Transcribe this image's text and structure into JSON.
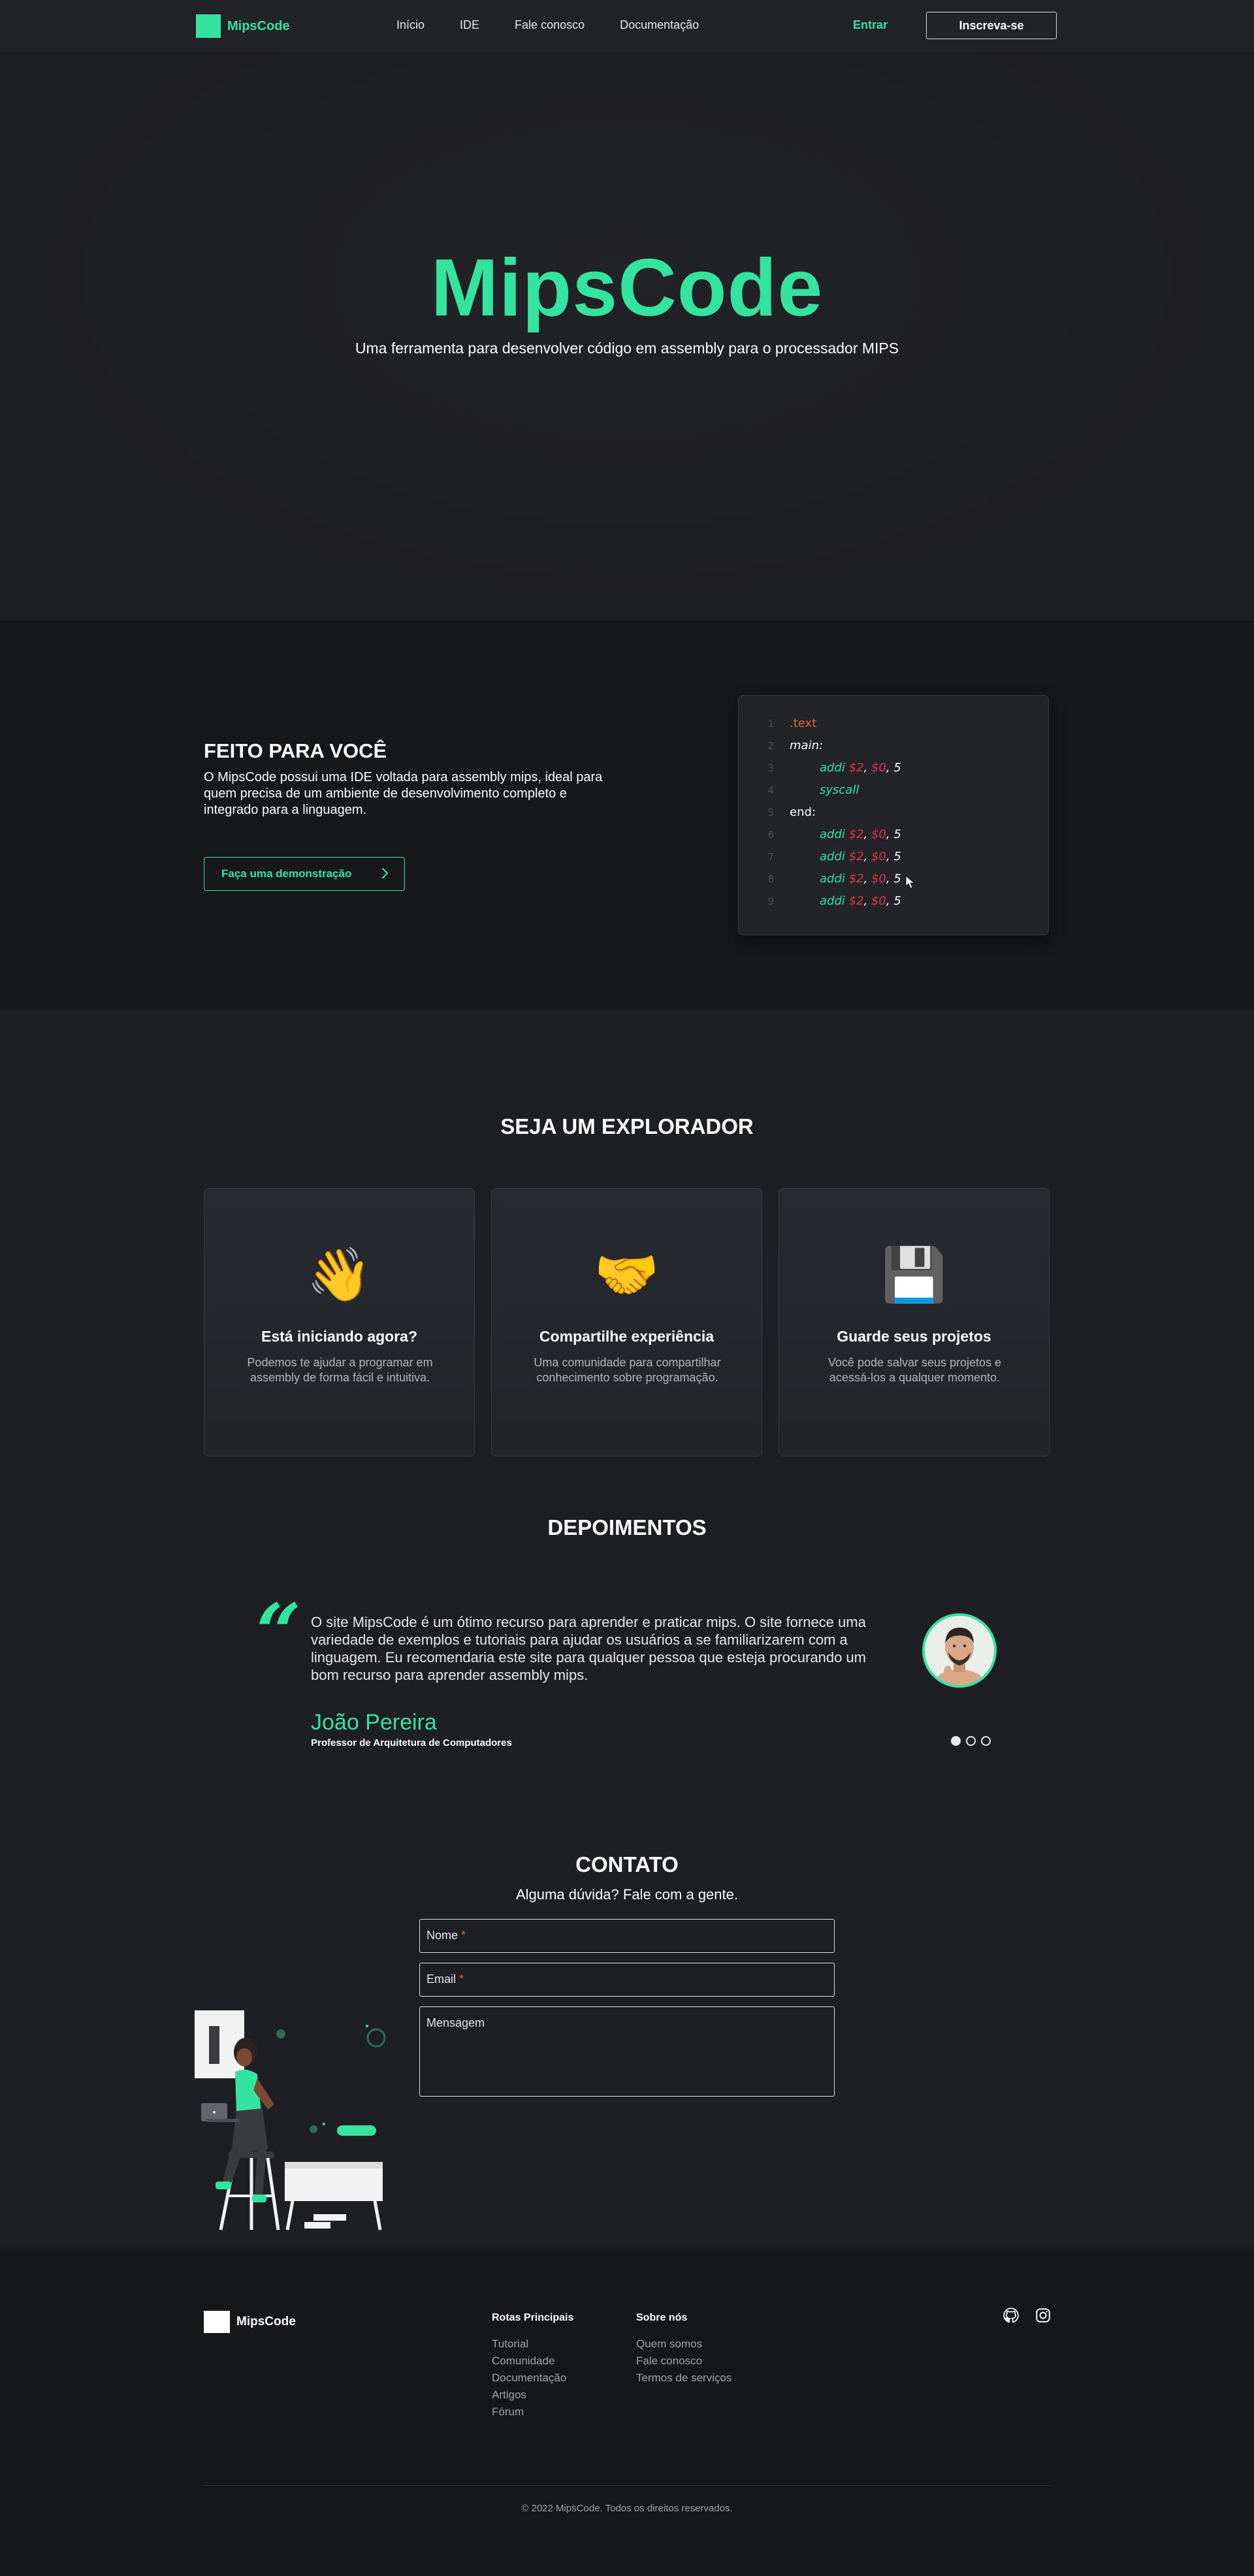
{
  "nav": {
    "brand": "MipsCode",
    "links": [
      "Início",
      "IDE",
      "Fale conosco",
      "Documentação"
    ],
    "login": "Entrar",
    "signup": "Inscreva-se"
  },
  "hero": {
    "title": "MipsCode",
    "subtitle": "Uma ferramenta para desenvolver código em assembly para o processador MIPS"
  },
  "feature": {
    "title": "FEITO PARA VOCÊ",
    "description": "O MipsCode possui uma IDE voltada para assembly mips, ideal para quem precisa de um ambiente de desenvolvimento completo e integrado para a linguagem.",
    "button": "Faça uma demonstração",
    "code_lines": [
      {
        "n": "1",
        "text": ".text"
      },
      {
        "n": "2",
        "text": "main:"
      },
      {
        "n": "3",
        "op": "addi",
        "args": [
          "$2",
          "$0",
          "5"
        ]
      },
      {
        "n": "4",
        "op": "syscall"
      },
      {
        "n": "5",
        "text": "end:"
      },
      {
        "n": "6",
        "op": "addi",
        "args": [
          "$2",
          "$0",
          "5"
        ]
      },
      {
        "n": "7",
        "op": "addi",
        "args": [
          "$2",
          "$0",
          "5"
        ]
      },
      {
        "n": "8",
        "op": "addi",
        "args": [
          "$2",
          "$0",
          "5"
        ]
      },
      {
        "n": "9",
        "op": "addi",
        "args": [
          "$2",
          "$0",
          "5"
        ]
      }
    ]
  },
  "explorer": {
    "title": "SEJA UM EXPLORADOR",
    "cards": [
      {
        "icon": "waving-hand-icon",
        "glyph": "👋",
        "title": "Está iniciando agora?",
        "desc": "Podemos te ajudar a programar em assembly de forma fácil e intuitiva."
      },
      {
        "icon": "handshake-icon",
        "glyph": "🤝",
        "title": "Compartilhe experiência",
        "desc": "Uma comunidade para compartilhar conhecimento sobre programação."
      },
      {
        "icon": "floppy-disk-icon",
        "glyph": "💾",
        "title": "Guarde seus projetos",
        "desc": "Você pode salvar seus projetos e acessá-los a qualquer momento."
      }
    ]
  },
  "testimonials": {
    "title": "DEPOIMENTOS",
    "quote": "O site MipsCode é um ótimo recurso para aprender e praticar mips. O site fornece uma variedade de exemplos e tutoriais para ajudar os usuários a se familiarizarem com a linguagem. Eu recomendaria este site para qualquer pessoa que esteja procurando um bom recurso para aprender assembly mips.",
    "name": "João Pereira",
    "role": "Professor de Arquitetura de Computadores",
    "active_dot": 0,
    "dot_count": 3
  },
  "contact": {
    "title": "CONTATO",
    "subtitle": "Alguma dúvida? Fale com a gente.",
    "name_placeholder": "Nome",
    "email_placeholder": "Email",
    "message_placeholder": "Mensagem",
    "required_mark": "*"
  },
  "footer": {
    "brand": "MipsCode",
    "col1_title": "Rotas Principais",
    "col1_links": [
      "Tutorial",
      "Comunidade",
      "Documentação",
      "Artigos",
      "Fórum"
    ],
    "col2_title": "Sobre nós",
    "col2_links": [
      "Quem somos",
      "Fale conosco",
      "Termos de serviços"
    ],
    "social": [
      "github-icon",
      "instagram-icon"
    ],
    "copyright": "© 2022 MipsCode. Todos os direitos reservados."
  },
  "colors": {
    "accent": "#34e3a0",
    "background": "#1e1f22",
    "register": "#e0344e",
    "directive": "#e8623b"
  }
}
